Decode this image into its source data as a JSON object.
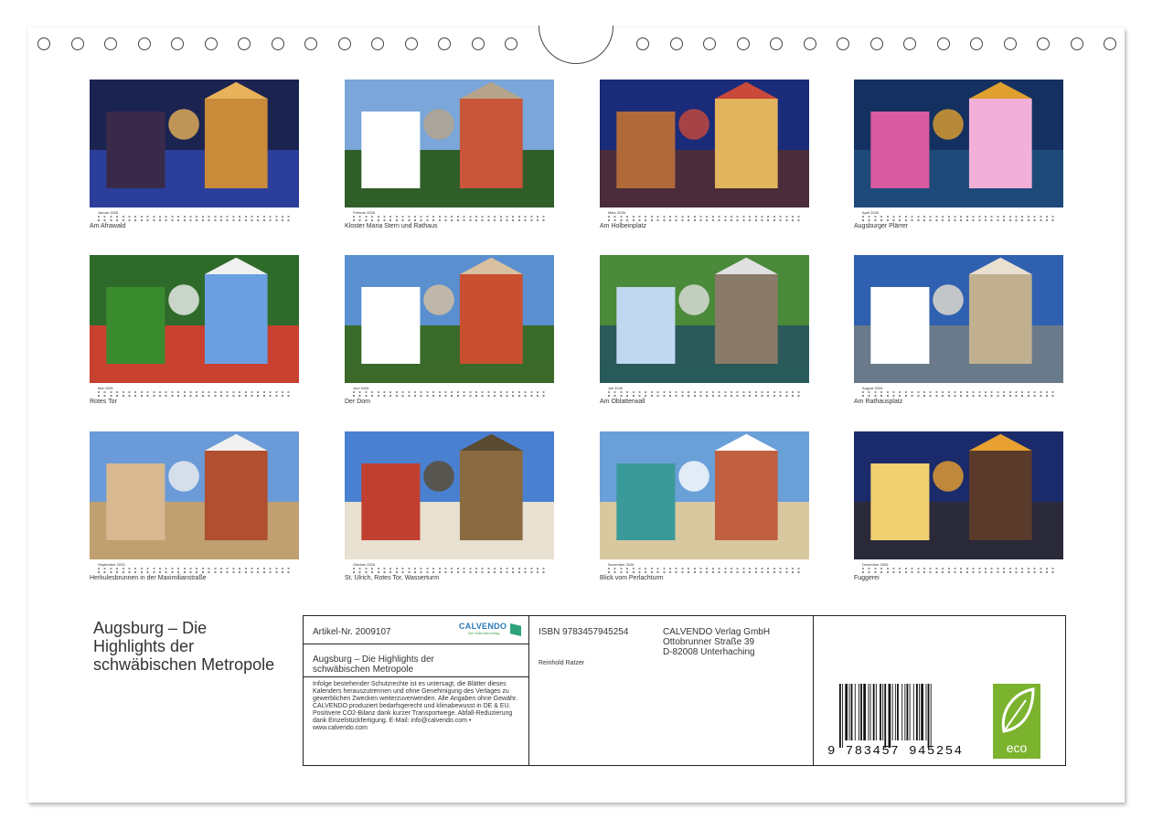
{
  "months": [
    {
      "name": "Januar 2026",
      "caption": "Am Afrawald"
    },
    {
      "name": "Februar 2026",
      "caption": "Kloster Maria Stern und Rathaus"
    },
    {
      "name": "März 2026",
      "caption": "Am Holbeinplatz"
    },
    {
      "name": "April 2026",
      "caption": "Augsburger Plärrer"
    },
    {
      "name": "Mai 2026",
      "caption": "Rotes Tor"
    },
    {
      "name": "Juni 2026",
      "caption": "Der Dom"
    },
    {
      "name": "Juli 2026",
      "caption": "Am Oblatterwall"
    },
    {
      "name": "August 2026",
      "caption": "Am Rathausplatz"
    },
    {
      "name": "September 2026",
      "caption": "Herkulesbrunnen in der Maximilianstraße"
    },
    {
      "name": "Oktober 2026",
      "caption": "St. Ulrich, Rotes Tor, Wasserturm"
    },
    {
      "name": "November 2026",
      "caption": "Blick vom Perlachturm"
    },
    {
      "name": "Dezember 2026",
      "caption": "Fuggerei"
    }
  ],
  "title": "Augsburg – Die Highlights der schwäbischen Metropole",
  "info": {
    "article": "Artikel-Nr. 2009107",
    "brand": "CALVENDO",
    "brand_sub": "Der Kalenderverlag",
    "subtitle": "Augsburg – Die Highlights der schwäbischen Metropole",
    "legal": "Infolge bestehender Schutzrechte ist es untersagt, die Blätter dieses Kalenders herauszutrennen und ohne Genehmigung des Verlages zu gewerblichen Zwecken weiterzuverwenden. Alle Angaben ohne Gewähr. CALVENDO produziert bedarfsgerecht und klimabewusst in DE & EU. Positivere CO2-Bilanz dank kurzer Transportwege. Abfall-Reduzierung dank Einzelstückfertigung. E-Mail: info@calvendo.com • www.calvendo.com",
    "isbn": "ISBN 9783457945254",
    "author": "Reinhold Ratzer",
    "publisher_name": "CALVENDO Verlag GmbH",
    "publisher_street": "Ottobrunner Straße 39",
    "publisher_city": "D-82008 Unterhaching",
    "barcode_digits": "9 783457 945254",
    "eco_label": "eco"
  }
}
